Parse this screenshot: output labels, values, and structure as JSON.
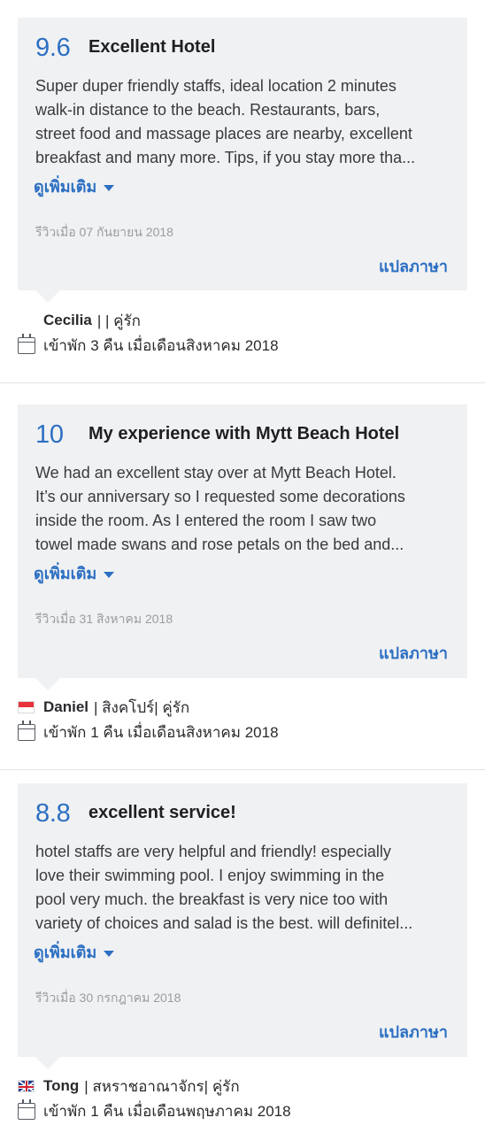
{
  "ui": {
    "read_more_label": "ดูเพิ่มเติม",
    "translate_label": "แปลภาษา",
    "more_caret_icon": "caret-down-icon",
    "calendar_icon": "calendar-icon",
    "accent_color": "#2c6fc2"
  },
  "reviews": [
    {
      "score": "9.6",
      "title": "Excellent Hotel",
      "body_lines": [
        "Super duper friendly staffs, ideal location 2 minutes",
        "walk-in distance to the beach. Restaurants, bars,",
        "street food and massage places are nearby, excellent",
        "breakfast and many more. Tips, if you stay more tha..."
      ],
      "date": "รีวิวเมื่อ 07 กันยายน 2018",
      "reviewer_name": "Cecilia",
      "reviewer_meta": "| | คู่รัก",
      "flag": "none",
      "stay": "เข้าพัก 3 คืน เมื่อเดือนสิงหาคม 2018"
    },
    {
      "score": "10",
      "title": "My experience with Mytt Beach Hotel",
      "body_lines": [
        "We had an excellent stay over at Mytt Beach Hotel.",
        "It’s our anniversary so I requested some decorations",
        "inside the room. As I entered the room I saw two",
        "towel made swans and rose petals on the bed and..."
      ],
      "date": "รีวิวเมื่อ 31 สิงหาคม 2018",
      "reviewer_name": "Daniel",
      "reviewer_meta": "| สิงคโปร์| คู่รัก",
      "flag": "singapore-flag-icon",
      "stay": "เข้าพัก 1 คืน เมื่อเดือนสิงหาคม 2018"
    },
    {
      "score": "8.8",
      "title": "excellent service!",
      "body_lines": [
        "hotel staffs are very helpful and friendly! especially",
        "love their swimming pool. I enjoy swimming in the",
        "pool very much. the breakfast is very nice too with",
        "variety of choices and salad is the best. will definitel..."
      ],
      "date": "รีวิวเมื่อ 30 กรกฎาคม 2018",
      "reviewer_name": "Tong",
      "reviewer_meta": "| สหราชอาณาจักร| คู่รัก",
      "flag": "uk-flag-icon",
      "stay": "เข้าพัก 1 คืน เมื่อเดือนพฤษภาคม 2018"
    }
  ]
}
